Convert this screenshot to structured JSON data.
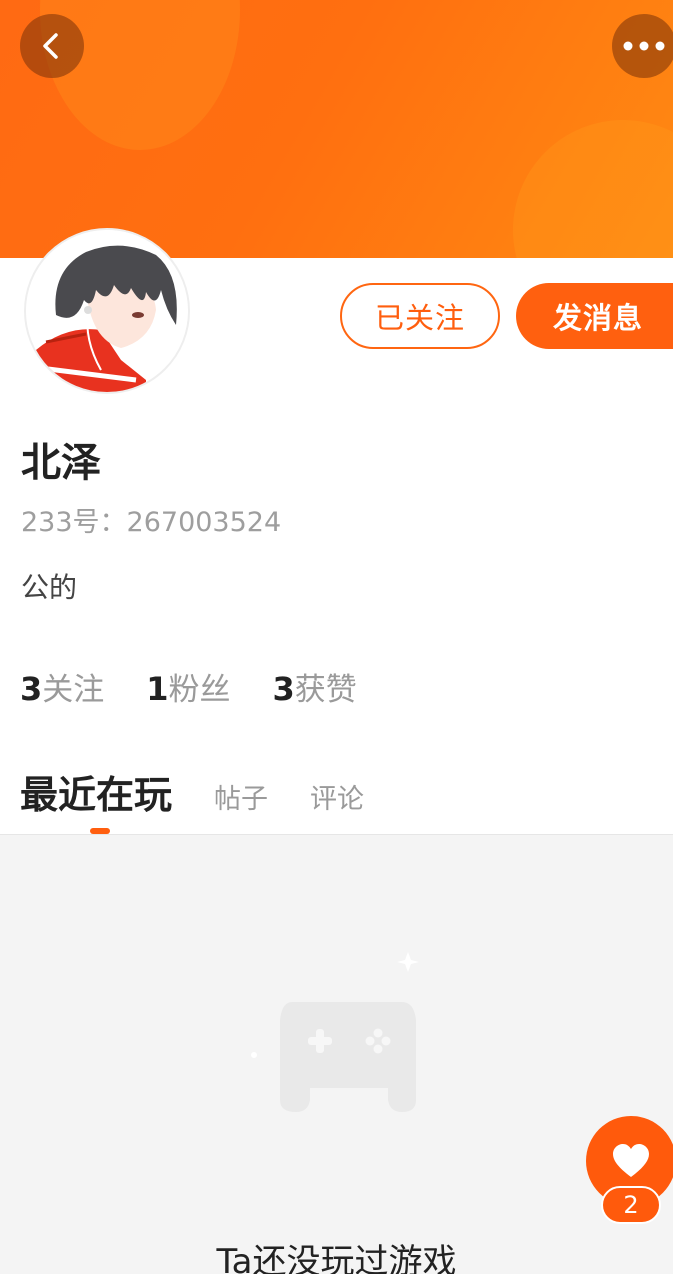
{
  "header": {
    "back_icon": "chevron-left-icon",
    "more_icon": "more-dots-icon",
    "accent_color": "#ff6a13"
  },
  "profile": {
    "name": "北泽",
    "id_text": "233号：267003524",
    "bio": "公的",
    "follow_button_label": "已关注",
    "message_button_label": "发消息"
  },
  "stats": [
    {
      "num": "3",
      "label": "关注"
    },
    {
      "num": "1",
      "label": "粉丝"
    },
    {
      "num": "3",
      "label": "获赞"
    }
  ],
  "tabs": [
    {
      "label": "最近在玩",
      "active": true
    },
    {
      "label": "帖子",
      "active": false
    },
    {
      "label": "评论",
      "active": false
    }
  ],
  "empty_state": {
    "icon": "gamepad-icon",
    "text": "Ta还没玩过游戏"
  },
  "like": {
    "icon": "heart-icon",
    "count": "2"
  }
}
